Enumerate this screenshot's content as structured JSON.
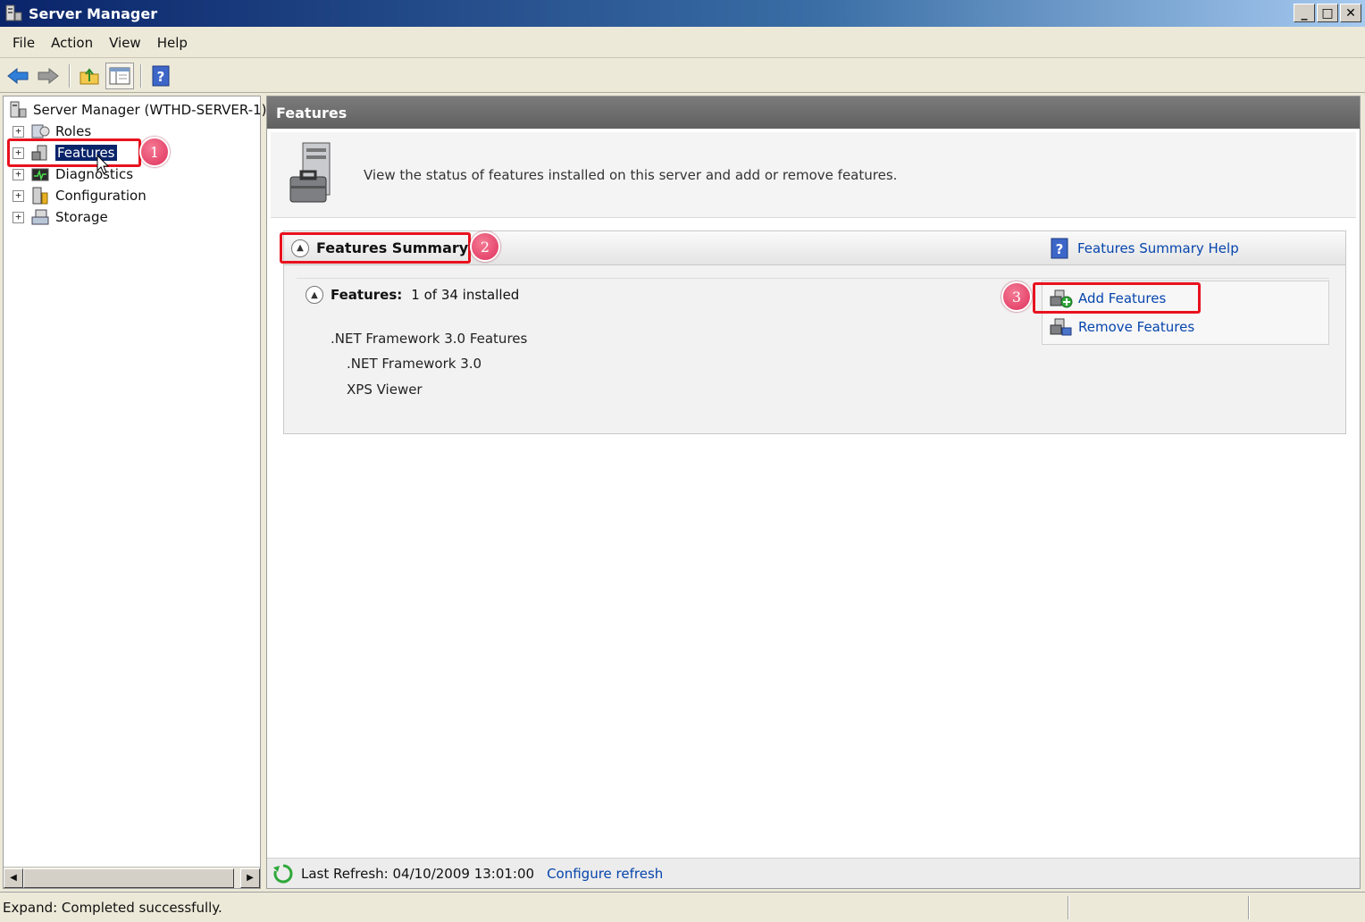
{
  "window": {
    "title": "Server Manager",
    "controls": {
      "minimize": "_",
      "maximize": "□",
      "close": "✕"
    }
  },
  "menu": {
    "items": [
      {
        "label": "File"
      },
      {
        "label": "Action"
      },
      {
        "label": "View"
      },
      {
        "label": "Help"
      }
    ]
  },
  "toolbar": {
    "buttons": [
      {
        "icon": "back-arrow-icon"
      },
      {
        "icon": "forward-arrow-icon"
      },
      {
        "icon": "up-folder-icon"
      },
      {
        "icon": "show-hide-console-tree-icon"
      },
      {
        "icon": "help-icon"
      }
    ]
  },
  "tree": {
    "root": "Server Manager (WTHD-SERVER-1)",
    "nodes": [
      {
        "label": "Roles",
        "icon": "roles-icon",
        "expander": "+"
      },
      {
        "label": "Features",
        "icon": "features-icon",
        "expander": "+",
        "selected": true
      },
      {
        "label": "Diagnostics",
        "icon": "diagnostics-icon",
        "expander": "+"
      },
      {
        "label": "Configuration",
        "icon": "configuration-icon",
        "expander": "+"
      },
      {
        "label": "Storage",
        "icon": "storage-icon",
        "expander": "+"
      }
    ]
  },
  "content": {
    "header": "Features",
    "description": "View the status of features installed on this server and add or remove features.",
    "summary": {
      "title": "Features Summary",
      "help_link": "Features Summary Help",
      "features_label": "Features:",
      "features_count": "1 of 34 installed",
      "items": [
        {
          "label": ".NET Framework 3.0 Features",
          "level": 0
        },
        {
          "label": ".NET Framework 3.0",
          "level": 1
        },
        {
          "label": "XPS Viewer",
          "level": 1
        }
      ],
      "actions": {
        "add": "Add Features",
        "remove": "Remove Features"
      }
    },
    "refresh": {
      "last_refresh": "Last Refresh: 04/10/2009 13:01:00",
      "configure": "Configure refresh"
    }
  },
  "status": {
    "text": "Expand:  Completed successfully."
  },
  "annotations": {
    "step1": "1",
    "step2": "2",
    "step3": "3",
    "color": "#e8121e"
  }
}
